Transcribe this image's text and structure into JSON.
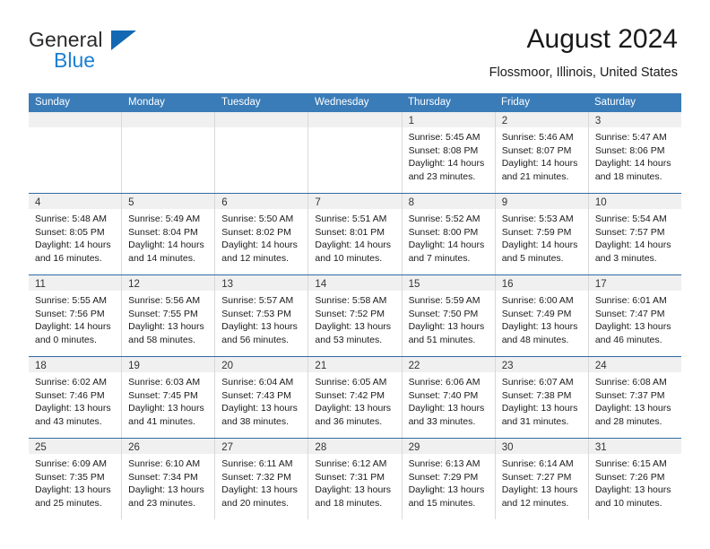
{
  "brand": {
    "name_top": "General",
    "name_bottom": "Blue",
    "accent_color": "#1268b3",
    "blue_text_color": "#1b7fd4"
  },
  "header": {
    "title": "August 2024",
    "subtitle": "Flossmoor, Illinois, United States"
  },
  "calendar": {
    "header_bg": "#3a7cb8",
    "header_text_color": "#ffffff",
    "daynum_bg": "#f0f0f0",
    "weekdays": [
      "Sunday",
      "Monday",
      "Tuesday",
      "Wednesday",
      "Thursday",
      "Friday",
      "Saturday"
    ],
    "weeks": [
      [
        {
          "empty": true
        },
        {
          "empty": true
        },
        {
          "empty": true
        },
        {
          "empty": true
        },
        {
          "day": "1",
          "sunrise": "Sunrise: 5:45 AM",
          "sunset": "Sunset: 8:08 PM",
          "daylight1": "Daylight: 14 hours",
          "daylight2": "and 23 minutes."
        },
        {
          "day": "2",
          "sunrise": "Sunrise: 5:46 AM",
          "sunset": "Sunset: 8:07 PM",
          "daylight1": "Daylight: 14 hours",
          "daylight2": "and 21 minutes."
        },
        {
          "day": "3",
          "sunrise": "Sunrise: 5:47 AM",
          "sunset": "Sunset: 8:06 PM",
          "daylight1": "Daylight: 14 hours",
          "daylight2": "and 18 minutes."
        }
      ],
      [
        {
          "day": "4",
          "sunrise": "Sunrise: 5:48 AM",
          "sunset": "Sunset: 8:05 PM",
          "daylight1": "Daylight: 14 hours",
          "daylight2": "and 16 minutes."
        },
        {
          "day": "5",
          "sunrise": "Sunrise: 5:49 AM",
          "sunset": "Sunset: 8:04 PM",
          "daylight1": "Daylight: 14 hours",
          "daylight2": "and 14 minutes."
        },
        {
          "day": "6",
          "sunrise": "Sunrise: 5:50 AM",
          "sunset": "Sunset: 8:02 PM",
          "daylight1": "Daylight: 14 hours",
          "daylight2": "and 12 minutes."
        },
        {
          "day": "7",
          "sunrise": "Sunrise: 5:51 AM",
          "sunset": "Sunset: 8:01 PM",
          "daylight1": "Daylight: 14 hours",
          "daylight2": "and 10 minutes."
        },
        {
          "day": "8",
          "sunrise": "Sunrise: 5:52 AM",
          "sunset": "Sunset: 8:00 PM",
          "daylight1": "Daylight: 14 hours",
          "daylight2": "and 7 minutes."
        },
        {
          "day": "9",
          "sunrise": "Sunrise: 5:53 AM",
          "sunset": "Sunset: 7:59 PM",
          "daylight1": "Daylight: 14 hours",
          "daylight2": "and 5 minutes."
        },
        {
          "day": "10",
          "sunrise": "Sunrise: 5:54 AM",
          "sunset": "Sunset: 7:57 PM",
          "daylight1": "Daylight: 14 hours",
          "daylight2": "and 3 minutes."
        }
      ],
      [
        {
          "day": "11",
          "sunrise": "Sunrise: 5:55 AM",
          "sunset": "Sunset: 7:56 PM",
          "daylight1": "Daylight: 14 hours",
          "daylight2": "and 0 minutes."
        },
        {
          "day": "12",
          "sunrise": "Sunrise: 5:56 AM",
          "sunset": "Sunset: 7:55 PM",
          "daylight1": "Daylight: 13 hours",
          "daylight2": "and 58 minutes."
        },
        {
          "day": "13",
          "sunrise": "Sunrise: 5:57 AM",
          "sunset": "Sunset: 7:53 PM",
          "daylight1": "Daylight: 13 hours",
          "daylight2": "and 56 minutes."
        },
        {
          "day": "14",
          "sunrise": "Sunrise: 5:58 AM",
          "sunset": "Sunset: 7:52 PM",
          "daylight1": "Daylight: 13 hours",
          "daylight2": "and 53 minutes."
        },
        {
          "day": "15",
          "sunrise": "Sunrise: 5:59 AM",
          "sunset": "Sunset: 7:50 PM",
          "daylight1": "Daylight: 13 hours",
          "daylight2": "and 51 minutes."
        },
        {
          "day": "16",
          "sunrise": "Sunrise: 6:00 AM",
          "sunset": "Sunset: 7:49 PM",
          "daylight1": "Daylight: 13 hours",
          "daylight2": "and 48 minutes."
        },
        {
          "day": "17",
          "sunrise": "Sunrise: 6:01 AM",
          "sunset": "Sunset: 7:47 PM",
          "daylight1": "Daylight: 13 hours",
          "daylight2": "and 46 minutes."
        }
      ],
      [
        {
          "day": "18",
          "sunrise": "Sunrise: 6:02 AM",
          "sunset": "Sunset: 7:46 PM",
          "daylight1": "Daylight: 13 hours",
          "daylight2": "and 43 minutes."
        },
        {
          "day": "19",
          "sunrise": "Sunrise: 6:03 AM",
          "sunset": "Sunset: 7:45 PM",
          "daylight1": "Daylight: 13 hours",
          "daylight2": "and 41 minutes."
        },
        {
          "day": "20",
          "sunrise": "Sunrise: 6:04 AM",
          "sunset": "Sunset: 7:43 PM",
          "daylight1": "Daylight: 13 hours",
          "daylight2": "and 38 minutes."
        },
        {
          "day": "21",
          "sunrise": "Sunrise: 6:05 AM",
          "sunset": "Sunset: 7:42 PM",
          "daylight1": "Daylight: 13 hours",
          "daylight2": "and 36 minutes."
        },
        {
          "day": "22",
          "sunrise": "Sunrise: 6:06 AM",
          "sunset": "Sunset: 7:40 PM",
          "daylight1": "Daylight: 13 hours",
          "daylight2": "and 33 minutes."
        },
        {
          "day": "23",
          "sunrise": "Sunrise: 6:07 AM",
          "sunset": "Sunset: 7:38 PM",
          "daylight1": "Daylight: 13 hours",
          "daylight2": "and 31 minutes."
        },
        {
          "day": "24",
          "sunrise": "Sunrise: 6:08 AM",
          "sunset": "Sunset: 7:37 PM",
          "daylight1": "Daylight: 13 hours",
          "daylight2": "and 28 minutes."
        }
      ],
      [
        {
          "day": "25",
          "sunrise": "Sunrise: 6:09 AM",
          "sunset": "Sunset: 7:35 PM",
          "daylight1": "Daylight: 13 hours",
          "daylight2": "and 25 minutes."
        },
        {
          "day": "26",
          "sunrise": "Sunrise: 6:10 AM",
          "sunset": "Sunset: 7:34 PM",
          "daylight1": "Daylight: 13 hours",
          "daylight2": "and 23 minutes."
        },
        {
          "day": "27",
          "sunrise": "Sunrise: 6:11 AM",
          "sunset": "Sunset: 7:32 PM",
          "daylight1": "Daylight: 13 hours",
          "daylight2": "and 20 minutes."
        },
        {
          "day": "28",
          "sunrise": "Sunrise: 6:12 AM",
          "sunset": "Sunset: 7:31 PM",
          "daylight1": "Daylight: 13 hours",
          "daylight2": "and 18 minutes."
        },
        {
          "day": "29",
          "sunrise": "Sunrise: 6:13 AM",
          "sunset": "Sunset: 7:29 PM",
          "daylight1": "Daylight: 13 hours",
          "daylight2": "and 15 minutes."
        },
        {
          "day": "30",
          "sunrise": "Sunrise: 6:14 AM",
          "sunset": "Sunset: 7:27 PM",
          "daylight1": "Daylight: 13 hours",
          "daylight2": "and 12 minutes."
        },
        {
          "day": "31",
          "sunrise": "Sunrise: 6:15 AM",
          "sunset": "Sunset: 7:26 PM",
          "daylight1": "Daylight: 13 hours",
          "daylight2": "and 10 minutes."
        }
      ]
    ]
  }
}
